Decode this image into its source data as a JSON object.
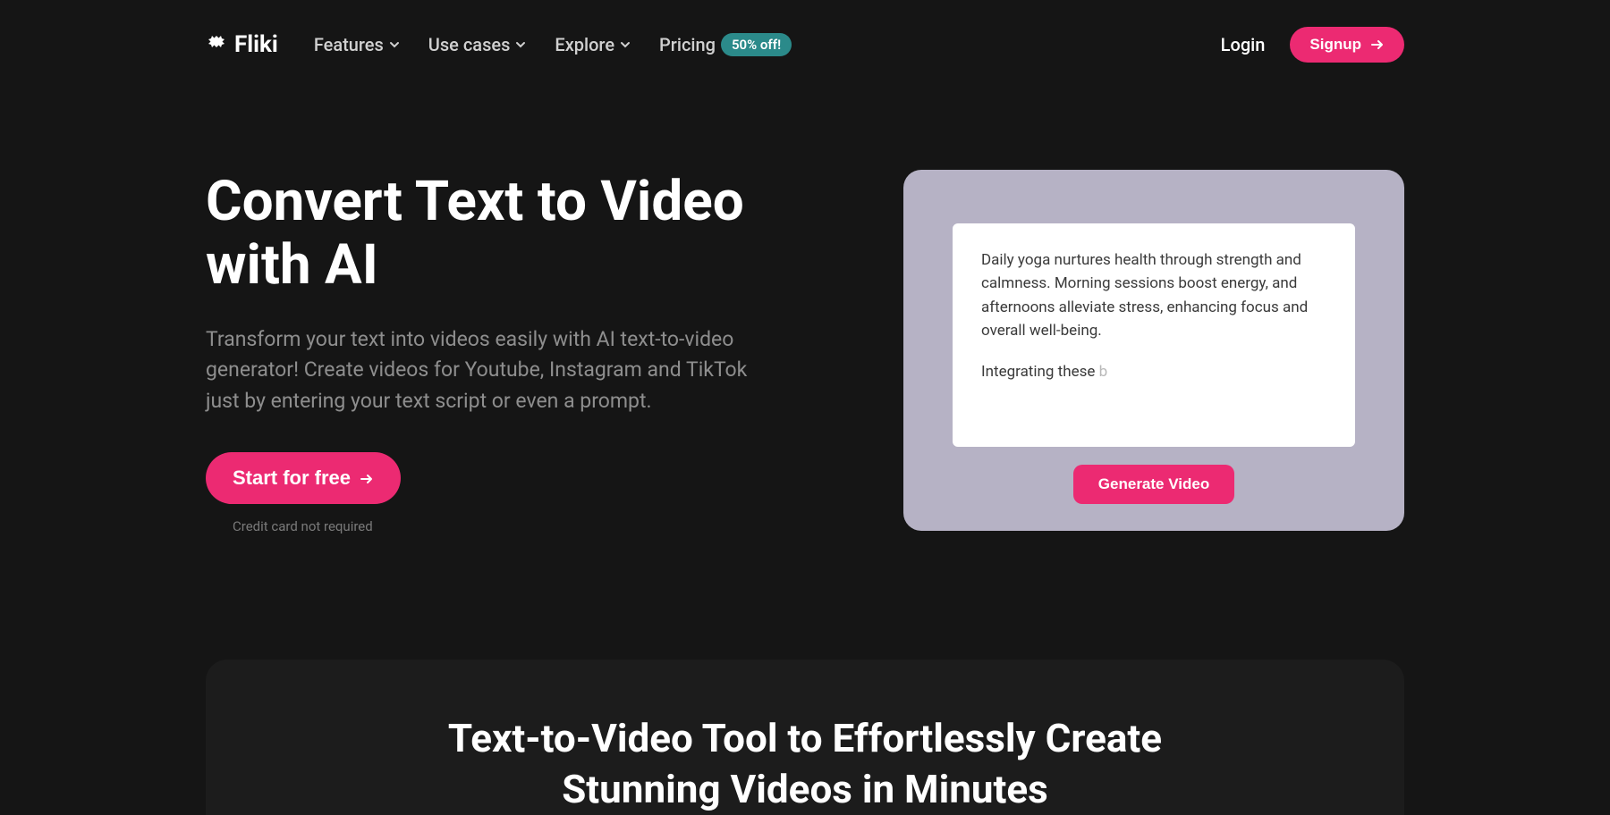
{
  "brand": "Fliki",
  "nav": {
    "items": [
      "Features",
      "Use cases",
      "Explore"
    ],
    "pricing": "Pricing",
    "badge": "50% off!"
  },
  "auth": {
    "login": "Login",
    "signup": "Signup"
  },
  "hero": {
    "title": "Convert Text to Video with AI",
    "subtitle": "Transform your text into videos easily with AI text-to-video generator! Create videos for Youtube, Instagram and TikTok just by entering your text script or even a prompt.",
    "cta": "Start for free",
    "note": "Credit card not required"
  },
  "demo": {
    "para1": "Daily yoga nurtures health through strength and calmness. Morning sessions boost energy, and afternoons alleviate stress, enhancing focus and overall well-being.",
    "para2_start": "Integrating these ",
    "para2_partial": "b",
    "button": "Generate Video"
  },
  "section2": {
    "title_line1": "Text-to-Video Tool to Effortlessly Create",
    "title_line2": "Stunning Videos in Minutes"
  }
}
